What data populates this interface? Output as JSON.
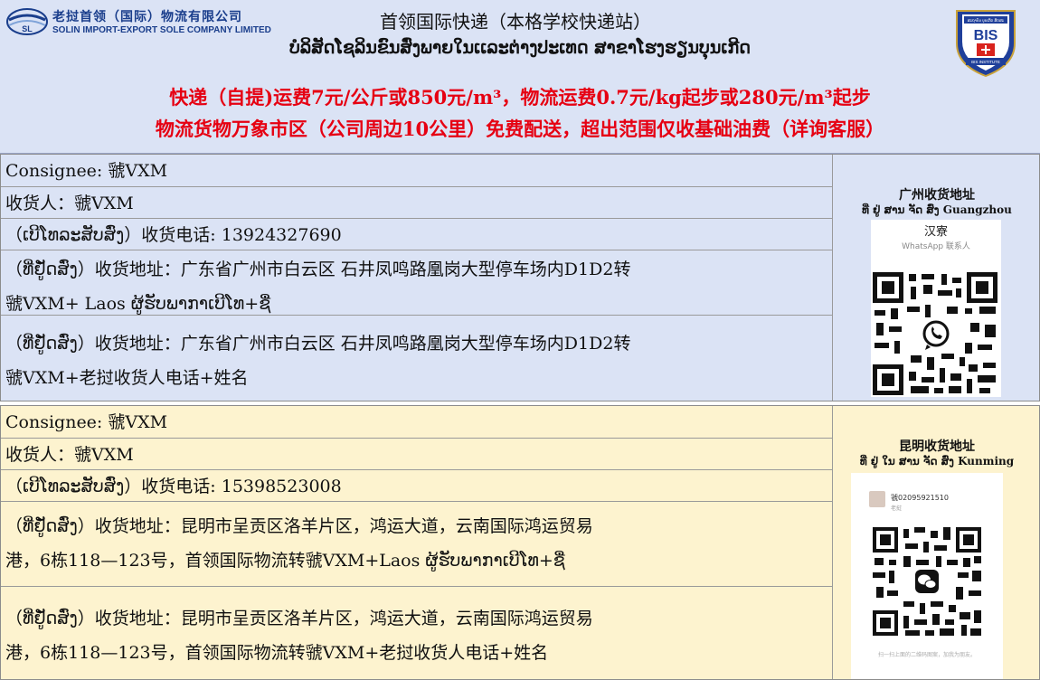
{
  "header": {
    "company_cn": "老挝首领（国际）物流有限公司",
    "company_en": "SOLIN IMPORT-EXPORT SOLE COMPANY LIMITED",
    "logo_mark": "SL",
    "title": "首领国际快递（本格学校快递站）",
    "lao_line": "ບໍລິສັດໂຊລິນຂົນສົ່ງພາຍໃນເເລະຕ່າງປະເທດ ສາຂາໂຮງຮຽນບຸນເກີດ",
    "notice_line1": "快递（自提)运费7元/公斤或850元/m³，物流运费0.7元/kg起步或280元/m³起步",
    "notice_line2": "物流货物万象市区（公司周边10公里）免费配送，超出范围仅收基础油费（详询客服）",
    "badge_top": "ສະຖາບັນ ບຸນເກີດ ສິດສະ",
    "badge_text": "BIS",
    "badge_bottom": "BIS INSTITUTE"
  },
  "guangzhou": {
    "consignee": "Consignee: 虢VXM",
    "receiver": "收货人：虢VXM",
    "phone": "（ເບີໂທລະສັບສົ່ງ）收货电话: 13924327690",
    "address1_line1": "（ທີ່ຢູ່ັດສົ່ງ）收货地址：广东省广州市白云区 石井凤鸣路凰岗大型停车场内D1D2转",
    "address1_line2": "虢VXM+ Laos ຜູ້ຮັບພາກາເບີໂທ+ຊື່",
    "address2_line1": "（ທີ່ຢູ່ັດສົ່ງ）收货地址：广东省广州市白云区 石井凤鸣路凰岗大型停车场内D1D2转",
    "address2_line2": "虢VXM+老挝收货人电话+姓名",
    "side_title": "广州收货地址",
    "side_sub": "ທີ່ ຢູ່ ສານ ຈັດ ສົ່ງ Guangzhou",
    "qr_name": "汉寮",
    "qr_caption": "WhatsApp 联系人"
  },
  "kunming": {
    "consignee": "Consignee: 虢VXM",
    "receiver": "收货人：虢VXM",
    "phone": "（ເບີໂທລະສັບສົ່ງ）收货电话: 15398523008",
    "address1_line1": "（ທີ່ຢູ່ັດສົ່ງ）收货地址：昆明市呈贡区洛羊片区，鸿运大道，云南国际鸿运贸易",
    "address1_line2": "港，6栋118—123号，首领国际物流转虢VXM+Laos ຜູ້ຮັບພາກາເບີໂທ+ຊື່",
    "address2_line1": "（ທີ່ຢູ່ັດສົ່ງ）收货地址：昆明市呈贡区洛羊片区，鸿运大道，云南国际鸿运贸易",
    "address2_line2": "港，6栋118—123号，首领国际物流转虢VXM+老挝收货人电话+姓名",
    "side_title": "昆明收货地址",
    "side_sub": "ທີ່ ຢູ່ ໃນ ສານ ຈັດ ສົ່ງ Kunming",
    "qr_id": "虢02095921510",
    "qr_sub": "老挝",
    "qr_footer": "扫一扫上面的二维码图案，加我为朋友。"
  },
  "colors": {
    "blue_bg": "#dbe3f5",
    "yellow_bg": "#fdf3cf",
    "notice_red": "#e60012",
    "brand_blue": "#1a3e8c"
  },
  "icons": {
    "whatsapp": "whatsapp-icon",
    "wechat": "wechat-icon"
  }
}
